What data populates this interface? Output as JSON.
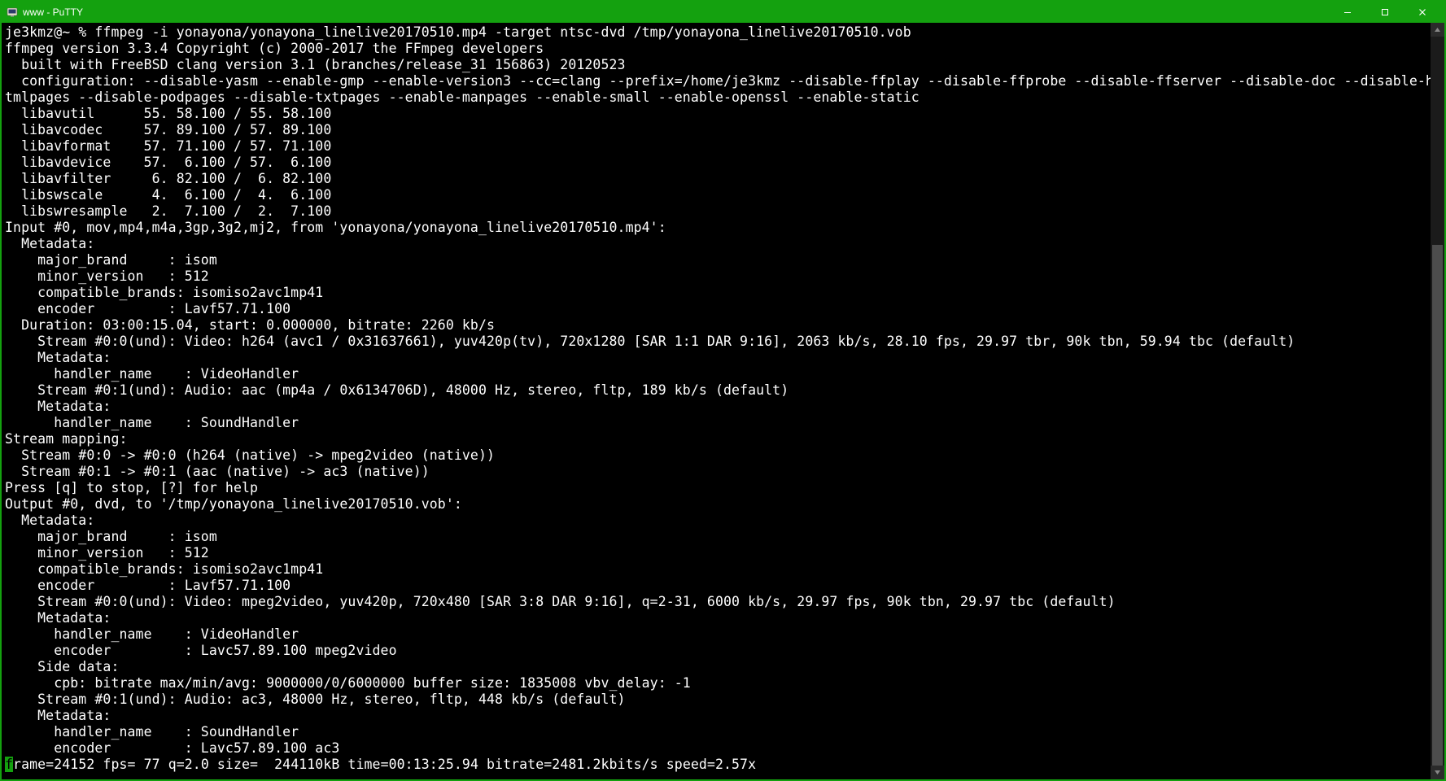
{
  "window": {
    "title": "www - PuTTY"
  },
  "terminal": {
    "lines": [
      "je3kmz@~ % ffmpeg -i yonayona/yonayona_linelive20170510.mp4 -target ntsc-dvd /tmp/yonayona_linelive20170510.vob",
      "ffmpeg version 3.3.4 Copyright (c) 2000-2017 the FFmpeg developers",
      "  built with FreeBSD clang version 3.1 (branches/release_31 156863) 20120523",
      "  configuration: --disable-yasm --enable-gmp --enable-version3 --cc=clang --prefix=/home/je3kmz --disable-ffplay --disable-ffprobe --disable-ffserver --disable-doc --disable-h",
      "tmlpages --disable-podpages --disable-txtpages --enable-manpages --enable-small --enable-openssl --enable-static",
      "  libavutil      55. 58.100 / 55. 58.100",
      "  libavcodec     57. 89.100 / 57. 89.100",
      "  libavformat    57. 71.100 / 57. 71.100",
      "  libavdevice    57.  6.100 / 57.  6.100",
      "  libavfilter     6. 82.100 /  6. 82.100",
      "  libswscale      4.  6.100 /  4.  6.100",
      "  libswresample   2.  7.100 /  2.  7.100",
      "Input #0, mov,mp4,m4a,3gp,3g2,mj2, from 'yonayona/yonayona_linelive20170510.mp4':",
      "  Metadata:",
      "    major_brand     : isom",
      "    minor_version   : 512",
      "    compatible_brands: isomiso2avc1mp41",
      "    encoder         : Lavf57.71.100",
      "  Duration: 03:00:15.04, start: 0.000000, bitrate: 2260 kb/s",
      "    Stream #0:0(und): Video: h264 (avc1 / 0x31637661), yuv420p(tv), 720x1280 [SAR 1:1 DAR 9:16], 2063 kb/s, 28.10 fps, 29.97 tbr, 90k tbn, 59.94 tbc (default)",
      "    Metadata:",
      "      handler_name    : VideoHandler",
      "    Stream #0:1(und): Audio: aac (mp4a / 0x6134706D), 48000 Hz, stereo, fltp, 189 kb/s (default)",
      "    Metadata:",
      "      handler_name    : SoundHandler",
      "Stream mapping:",
      "  Stream #0:0 -> #0:0 (h264 (native) -> mpeg2video (native))",
      "  Stream #0:1 -> #0:1 (aac (native) -> ac3 (native))",
      "Press [q] to stop, [?] for help",
      "Output #0, dvd, to '/tmp/yonayona_linelive20170510.vob':",
      "  Metadata:",
      "    major_brand     : isom",
      "    minor_version   : 512",
      "    compatible_brands: isomiso2avc1mp41",
      "    encoder         : Lavf57.71.100",
      "    Stream #0:0(und): Video: mpeg2video, yuv420p, 720x480 [SAR 3:8 DAR 9:16], q=2-31, 6000 kb/s, 29.97 fps, 90k tbn, 29.97 tbc (default)",
      "    Metadata:",
      "      handler_name    : VideoHandler",
      "      encoder         : Lavc57.89.100 mpeg2video",
      "    Side data:",
      "      cpb: bitrate max/min/avg: 9000000/0/6000000 buffer size: 1835008 vbv_delay: -1",
      "    Stream #0:1(und): Audio: ac3, 48000 Hz, stereo, fltp, 448 kb/s (default)",
      "    Metadata:",
      "      handler_name    : SoundHandler",
      "      encoder         : Lavc57.89.100 ac3"
    ],
    "status_first_char": "f",
    "status_rest": "rame=24152 fps= 77 q=2.0 size=  244110kB time=00:13:25.94 bitrate=2481.2kbits/s speed=2.57x"
  }
}
